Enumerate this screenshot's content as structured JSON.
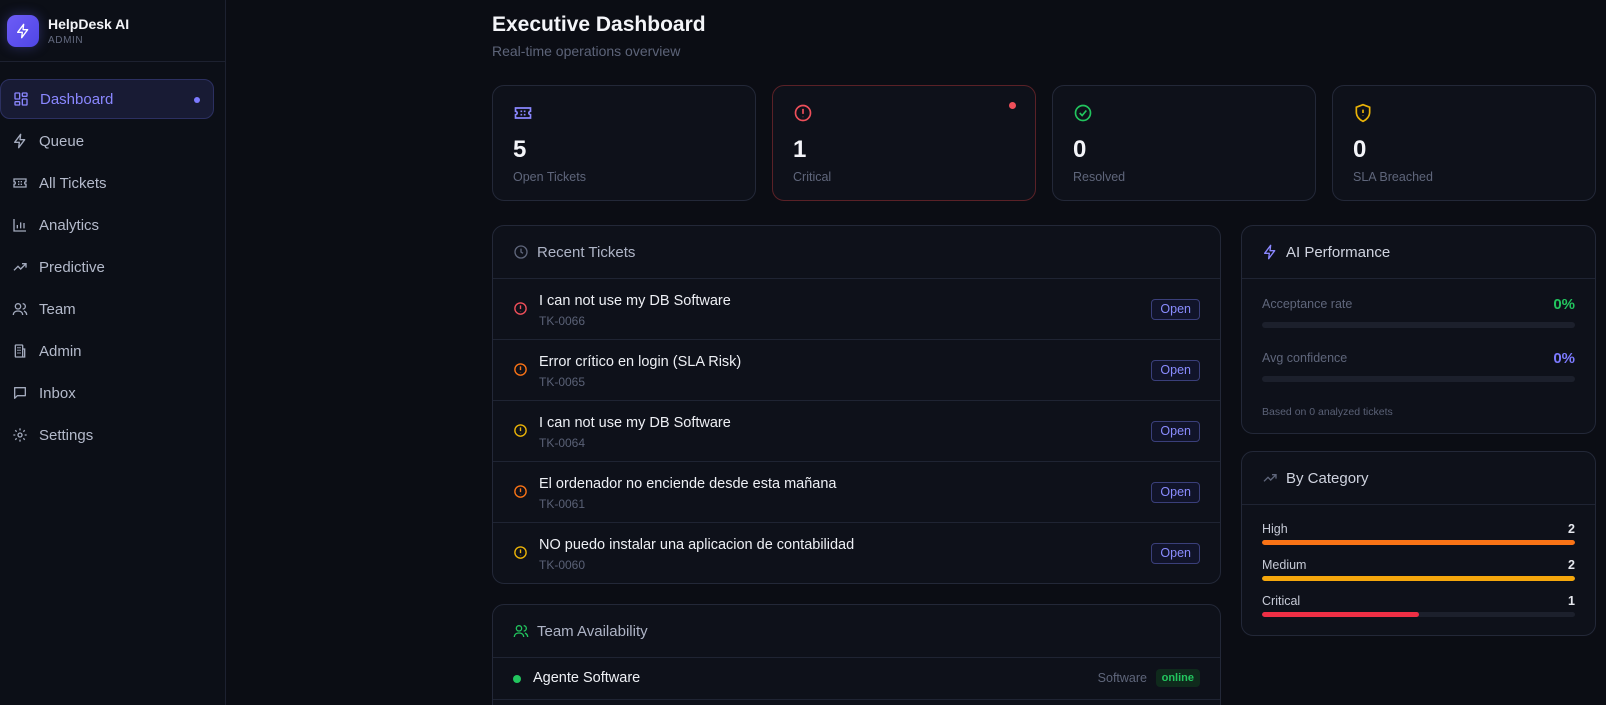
{
  "brand": {
    "name": "HelpDesk AI",
    "role": "ADMIN",
    "accent": "#6d5cf6"
  },
  "nav": {
    "items": [
      {
        "label": "Dashboard",
        "icon": "dashboard-grid-icon",
        "active": true
      },
      {
        "label": "Queue",
        "icon": "bolt-icon"
      },
      {
        "label": "All Tickets",
        "icon": "ticket-icon"
      },
      {
        "label": "Analytics",
        "icon": "bar-chart-icon"
      },
      {
        "label": "Predictive",
        "icon": "trending-up-icon"
      },
      {
        "label": "Team",
        "icon": "users-icon"
      },
      {
        "label": "Admin",
        "icon": "building-icon"
      },
      {
        "label": "Inbox",
        "icon": "message-icon"
      },
      {
        "label": "Settings",
        "icon": "gear-icon"
      }
    ]
  },
  "header": {
    "title": "Executive Dashboard",
    "subtitle": "Real-time operations overview"
  },
  "stats": [
    {
      "value": "5",
      "label": "Open Tickets",
      "icon": "ticket-icon",
      "color": "#8a87ff"
    },
    {
      "value": "1",
      "label": "Critical",
      "icon": "alert-circle-icon",
      "color": "#ef4f5a"
    },
    {
      "value": "0",
      "label": "Resolved",
      "icon": "check-circle-icon",
      "color": "#22c55e"
    },
    {
      "value": "0",
      "label": "SLA Breached",
      "icon": "shield-alert-icon",
      "color": "#eab308"
    }
  ],
  "recent": {
    "title": "Recent Tickets",
    "tickets": [
      {
        "title": "I can not use my DB Software",
        "id": "TK-0066",
        "status": "Open",
        "priority_color": "#ef4f5a"
      },
      {
        "title": "Error crítico en login (SLA Risk)",
        "id": "TK-0065",
        "status": "Open",
        "priority_color": "#f97316"
      },
      {
        "title": "I can not use my DB Software",
        "id": "TK-0064",
        "status": "Open",
        "priority_color": "#eab308"
      },
      {
        "title": "El ordenador no enciende desde esta mañana",
        "id": "TK-0061",
        "status": "Open",
        "priority_color": "#f97316"
      },
      {
        "title": "NO puedo instalar una aplicacion de contabilidad",
        "id": "TK-0060",
        "status": "Open",
        "priority_color": "#eab308"
      }
    ]
  },
  "team": {
    "title": "Team Availability",
    "members": [
      {
        "name": "Agente Software",
        "dept": "Software",
        "status": "online"
      }
    ]
  },
  "ai": {
    "title": "AI Performance",
    "acceptance_label": "Acceptance rate",
    "acceptance_value": "0%",
    "acceptance_pct": 0,
    "confidence_label": "Avg confidence",
    "confidence_value": "0%",
    "confidence_pct": 0,
    "note": "Based on 0 analyzed tickets"
  },
  "category": {
    "title": "By Category",
    "items": [
      {
        "label": "High",
        "value": "2",
        "fraction": 1.0,
        "color": "#f97316"
      },
      {
        "label": "Medium",
        "value": "2",
        "fraction": 1.0,
        "color": "#f5a70c"
      },
      {
        "label": "Critical",
        "value": "1",
        "fraction": 0.5,
        "color": "#ef2f45"
      }
    ]
  }
}
